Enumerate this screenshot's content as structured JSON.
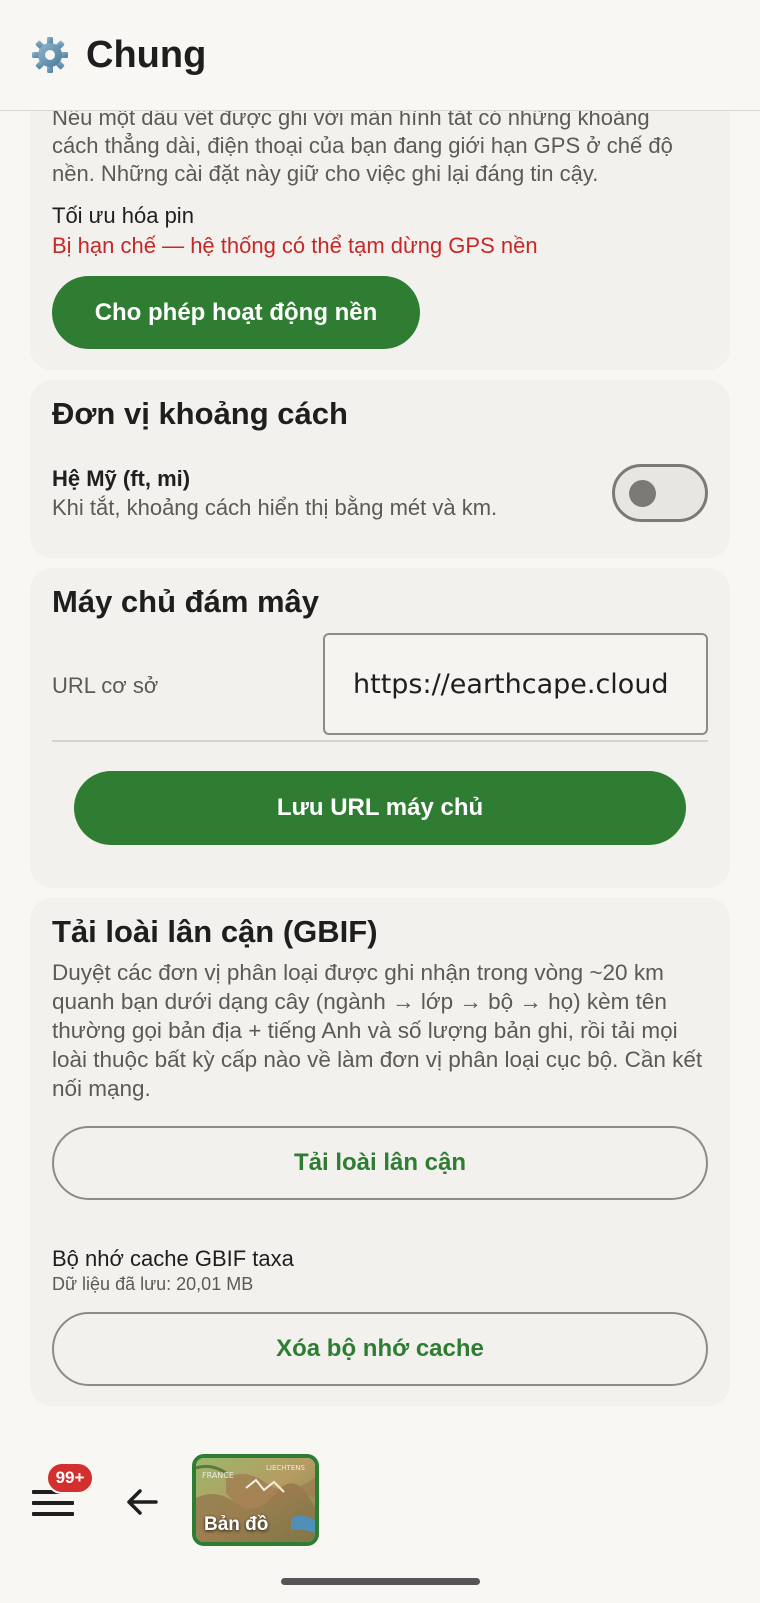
{
  "header": {
    "title": "Chung",
    "icon": "gear-icon"
  },
  "battery_section": {
    "intro_text": "Nếu một dấu vết được ghi với màn hình tắt có những khoảng cách thẳng dài, điện thoại của bạn đang giới hạn GPS ở chế độ nền. Những cài đặt này giữ cho việc ghi lại đáng tin cậy.",
    "label": "Tối ưu hóa pin",
    "status": "Bị hạn chế — hệ thống có thể tạm dừng GPS nền",
    "button": "Cho phép hoạt động nền"
  },
  "units_section": {
    "title": "Đơn vị khoảng cách",
    "toggle_label": "Hệ Mỹ (ft, mi)",
    "toggle_desc": "Khi tắt, khoảng cách hiển thị bằng mét và km.",
    "toggle_on": false
  },
  "server_section": {
    "title": "Máy chủ đám mây",
    "field_label": "URL cơ sở",
    "field_value": "https://earthcape.cloud",
    "button": "Lưu URL máy chủ"
  },
  "gbif_section": {
    "title": "Tải loài lân cận (GBIF)",
    "description": "Duyệt các đơn vị phân loại được ghi nhận trong vòng ~20 km quanh bạn dưới dạng cây (ngành → lớp → bộ → họ) kèm tên thường gọi bản địa + tiếng Anh và số lượng bản ghi, rồi tải mọi loài thuộc bất kỳ cấp nào về làm đơn vị phân loại cục bộ. Cần kết nối mạng.",
    "load_button": "Tải loài lân cận",
    "cache_label": "Bộ nhớ cache GBIF taxa",
    "cache_info": "Dữ liệu đã lưu: 20,01 MB",
    "clear_button": "Xóa bộ nhớ cache"
  },
  "bottom_bar": {
    "badge": "99+",
    "map_label": "Bản đồ",
    "map_text_1": "FRANCE",
    "map_text_2": "LIECHTENS"
  },
  "colors": {
    "accent": "#2e7d32",
    "warning": "#c62828",
    "badge": "#d32f2f"
  }
}
